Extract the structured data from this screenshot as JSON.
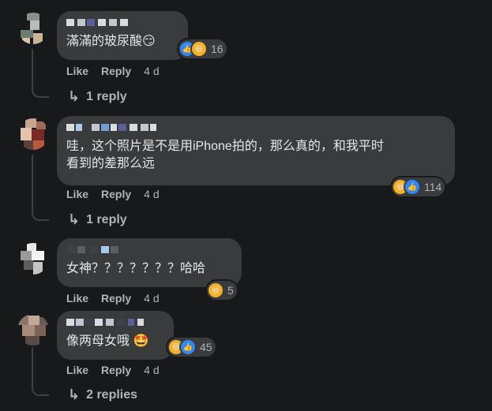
{
  "comments": [
    {
      "text": "滿滿的玻尿酸😏",
      "reactions": {
        "icons": [
          "like-icon",
          "haha-icon"
        ],
        "count": "16"
      },
      "actions": {
        "like": "Like",
        "reply": "Reply",
        "time": "4 d"
      },
      "replies_link": "1 reply"
    },
    {
      "text": "哇，这个照片是不是用iPhone拍的，那么真的，和我平时\n看到的差那么远",
      "reactions": {
        "icons": [
          "haha-icon",
          "like-icon"
        ],
        "count": "114"
      },
      "actions": {
        "like": "Like",
        "reply": "Reply",
        "time": "4 d"
      },
      "replies_link": "1 reply"
    },
    {
      "text": "女神？？？？？？？哈哈",
      "reactions": {
        "icons": [
          "haha-icon"
        ],
        "count": "5"
      },
      "actions": {
        "like": "Like",
        "reply": "Reply",
        "time": "4 d"
      }
    },
    {
      "text": "像两母女哦 🤩",
      "reactions": {
        "icons": [
          "haha-icon",
          "like-icon"
        ],
        "count": "45"
      },
      "actions": {
        "like": "Like",
        "reply": "Reply",
        "time": "4 d"
      },
      "replies_link": "2 replies"
    }
  ],
  "icons": {
    "reply_arrow": "reply-arrow-icon"
  },
  "colors": {
    "background": "#18191a",
    "bubble": "#3a3b3c",
    "secondary_text": "#b0b3b8",
    "like_blue": "#2d88ff",
    "haha_yellow": "#f7b125"
  }
}
